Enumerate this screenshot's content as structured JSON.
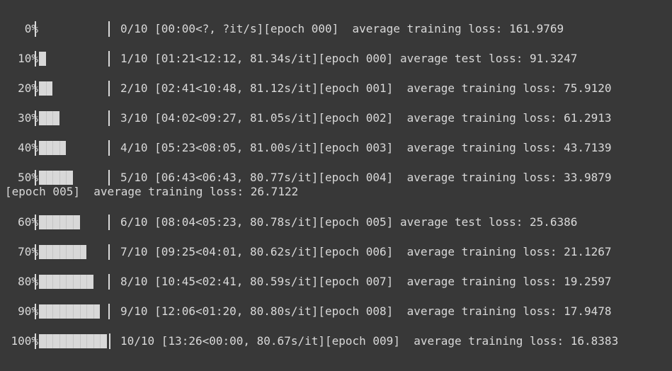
{
  "progress_lines": [
    {
      "percent": "0%",
      "fraction": 0.0,
      "stats": "0/10 [00:00<?, ?it/s][epoch 000]  average training loss: 161.9769"
    },
    {
      "percent": "10%",
      "fraction": 0.1,
      "stats": "1/10 [01:21<12:12, 81.34s/it][epoch 000] average test loss: 91.3247"
    },
    {
      "percent": "20%",
      "fraction": 0.2,
      "stats": "2/10 [02:41<10:48, 81.12s/it][epoch 001]  average training loss: 75.9120"
    },
    {
      "percent": "30%",
      "fraction": 0.3,
      "stats": "3/10 [04:02<09:27, 81.05s/it][epoch 002]  average training loss: 61.2913"
    },
    {
      "percent": "40%",
      "fraction": 0.4,
      "stats": "4/10 [05:23<08:05, 81.00s/it][epoch 003]  average training loss: 43.7139"
    },
    {
      "percent": "50%",
      "fraction": 0.5,
      "stats": "5/10 [06:43<06:43, 80.77s/it][epoch 004]  average training loss: 33.9879"
    },
    {
      "percent": "60%",
      "fraction": 0.6,
      "stats": "6/10 [08:04<05:23, 80.78s/it][epoch 005] average test loss: 25.6386"
    },
    {
      "percent": "70%",
      "fraction": 0.7,
      "stats": "7/10 [09:25<04:01, 80.62s/it][epoch 006]  average training loss: 21.1267"
    },
    {
      "percent": "80%",
      "fraction": 0.8,
      "stats": "8/10 [10:45<02:41, 80.59s/it][epoch 007]  average training loss: 19.2597"
    },
    {
      "percent": "90%",
      "fraction": 0.9,
      "stats": "9/10 [12:06<01:20, 80.80s/it][epoch 008]  average training loss: 17.9478"
    },
    {
      "percent": "100%",
      "fraction": 1.0,
      "stats": "10/10 [13:26<00:00, 80.67s/it][epoch 009]  average training loss: 16.8383"
    }
  ],
  "interleaved_line": "[epoch 005]  average training loss: 26.7122",
  "colors": {
    "background": "#383838",
    "text": "#d9d9d9",
    "bar_fill": "#d8d8d8"
  }
}
